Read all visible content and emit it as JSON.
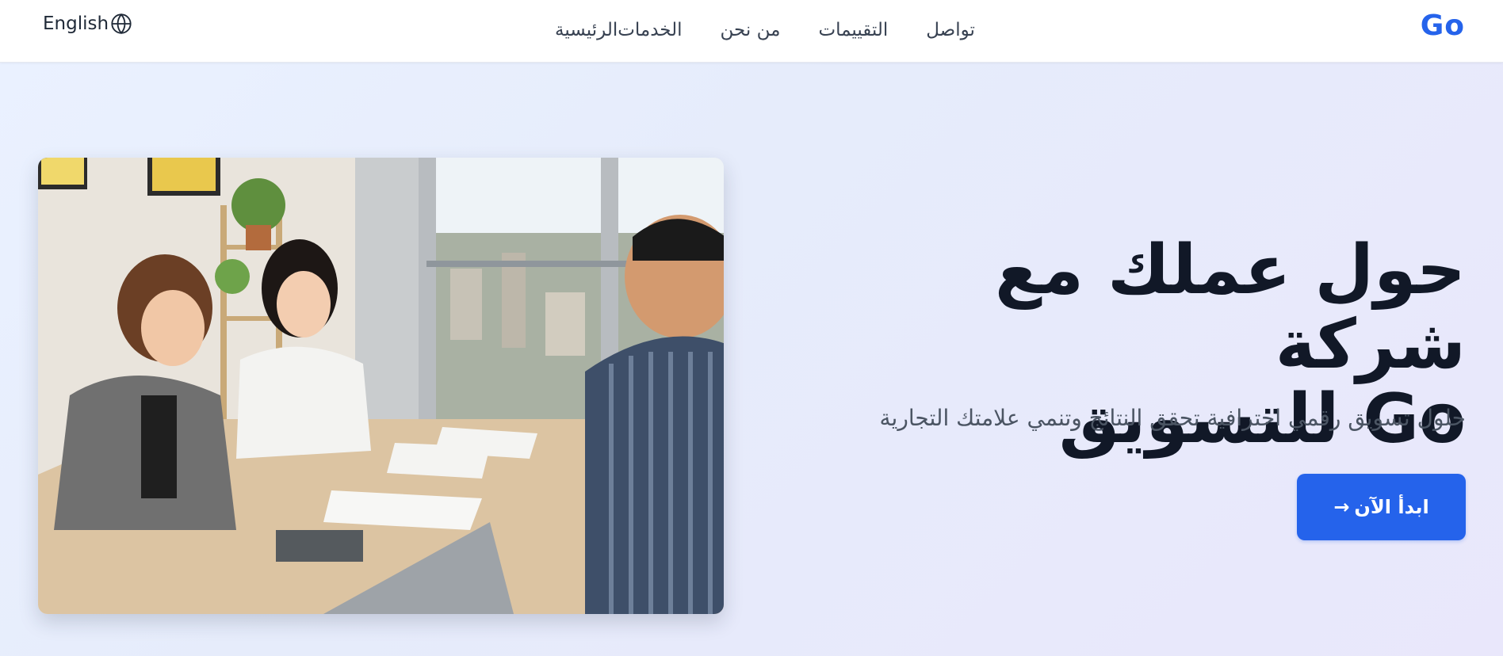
{
  "brand": {
    "logo": "Go",
    "accent_color": "#2563eb"
  },
  "nav": {
    "items": [
      {
        "label": "الرئيسية"
      },
      {
        "label": "الخدمات"
      },
      {
        "label": "من نحن"
      },
      {
        "label": "التقييمات"
      },
      {
        "label": "تواصل"
      }
    ],
    "language_label": "English",
    "language_icon": "globe-icon"
  },
  "hero": {
    "headline_line1": "حول عملك مع شركة",
    "headline_line2": "Go للتسويق",
    "subtitle": "حلول تسويق رقمي احترافية تحقق النتائج وتنمي علامتك التجارية",
    "cta_label": "ابدأ الآن",
    "cta_icon": "arrow-right-icon",
    "image": "office-meeting-photo"
  }
}
